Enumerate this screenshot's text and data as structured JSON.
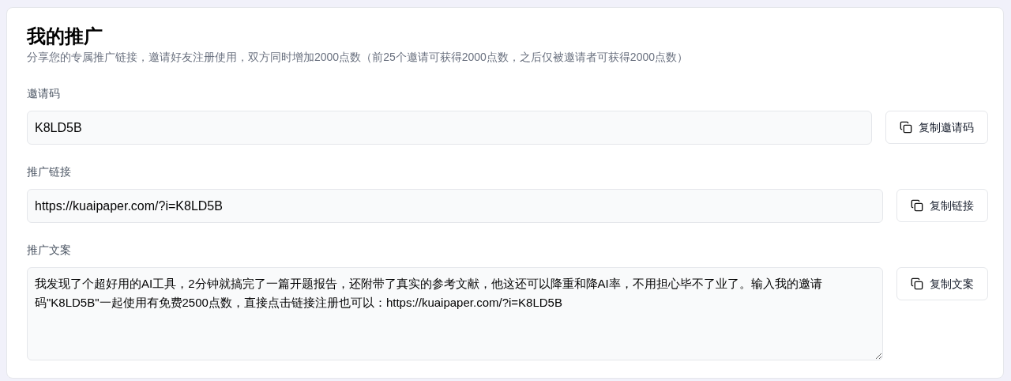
{
  "title": "我的推广",
  "subtitle": "分享您的专属推广链接，邀请好友注册使用，双方同时增加2000点数（前25个邀请可获得2000点数，之后仅被邀请者可获得2000点数）",
  "fields": [
    {
      "kind": "input",
      "label": "邀请码",
      "value": "K8LD5B",
      "button": "复制邀请码"
    },
    {
      "kind": "input",
      "label": "推广链接",
      "value": "https://kuaipaper.com/?i=K8LD5B",
      "button": "复制链接"
    },
    {
      "kind": "textarea",
      "label": "推广文案",
      "value": "我发现了个超好用的AI工具，2分钟就搞完了一篇开题报告，还附带了真实的参考文献，他这还可以降重和降AI率，不用担心毕不了业了。输入我的邀请码\"K8LD5B\"一起使用有免费2500点数，直接点击链接注册也可以：https://kuaipaper.com/?i=K8LD5B",
      "button": "复制文案"
    }
  ]
}
